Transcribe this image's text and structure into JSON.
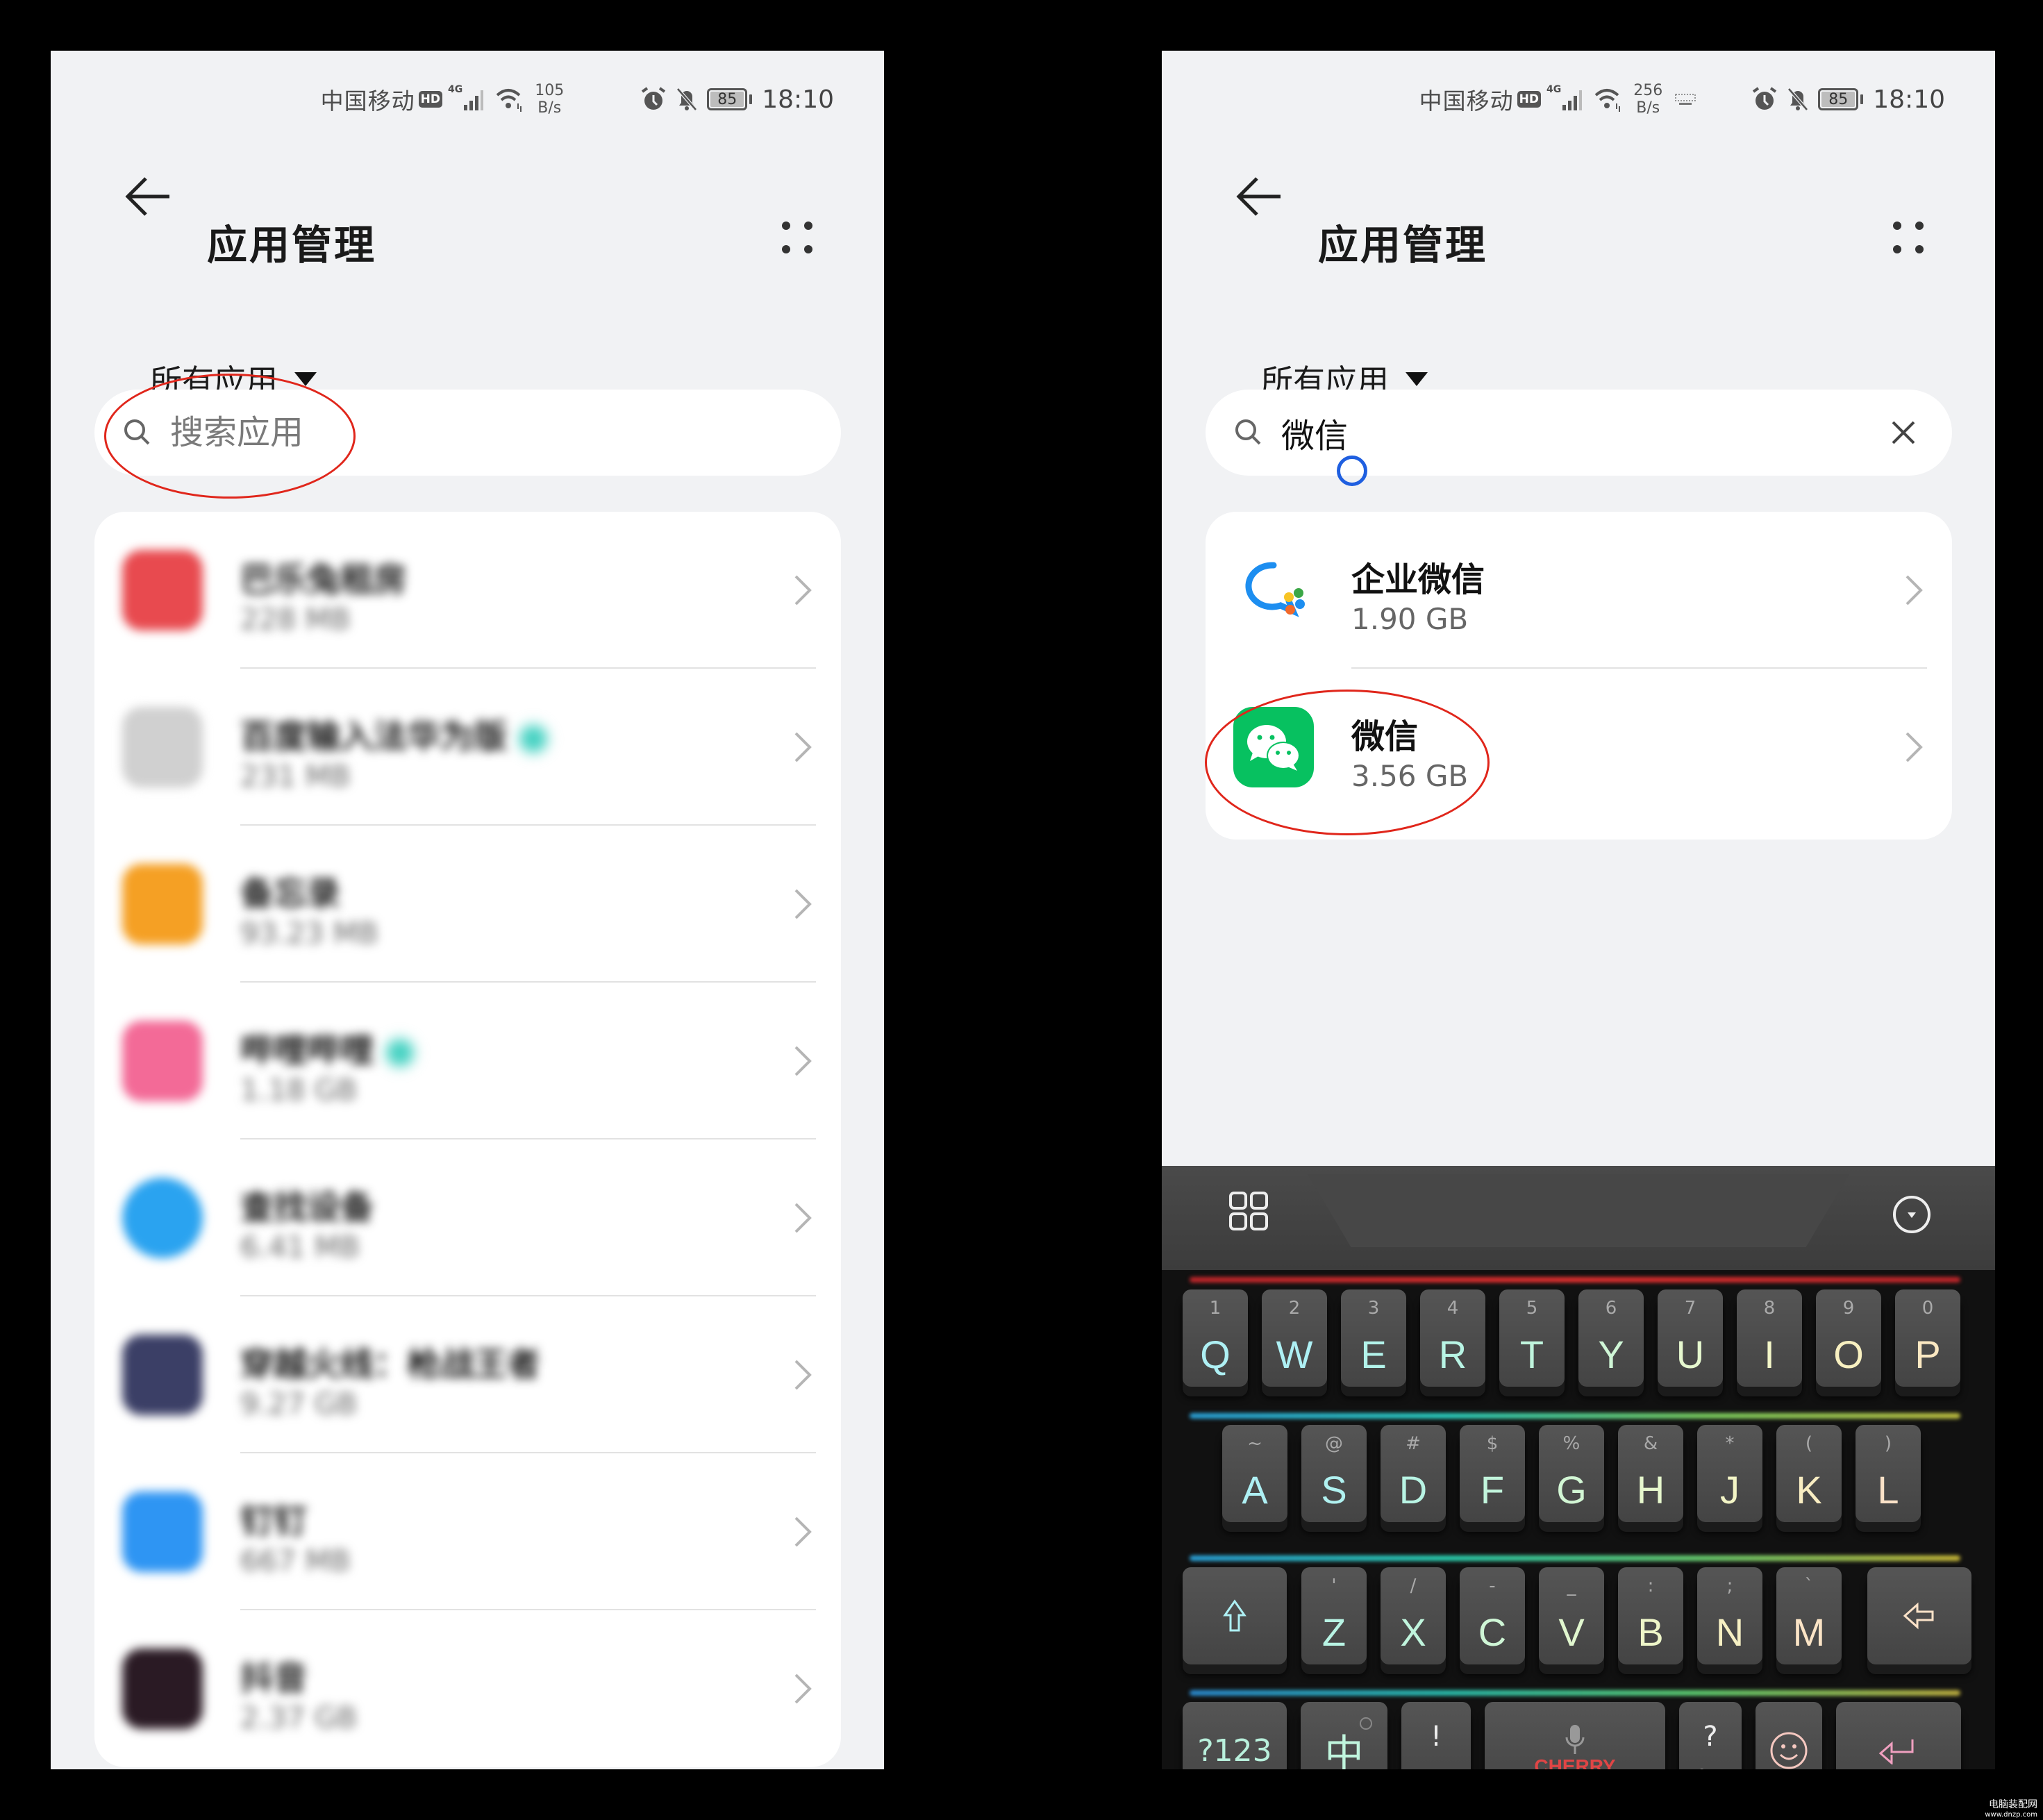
{
  "left_screen": {
    "status_bar": {
      "carrier": "中国移动",
      "hd_badge": "HD",
      "network": "4G",
      "speed_value": "105",
      "speed_unit": "B/s",
      "battery": "85",
      "time": "18:10"
    },
    "header": {
      "title": "应用管理"
    },
    "filter": {
      "label": "所有应用"
    },
    "search": {
      "placeholder": "搜索应用",
      "value": ""
    },
    "apps": [
      {
        "name": "巴乐兔租房",
        "size": "228 MB",
        "icon_color": "#e84a4f",
        "badge": false
      },
      {
        "name": "百度输入法华为版",
        "size": "231 MB",
        "icon_color": "#d0d0d0",
        "badge": true
      },
      {
        "name": "备忘录",
        "size": "93.23 MB",
        "icon_color": "#f5a024",
        "badge": false
      },
      {
        "name": "哔哩哔哩",
        "size": "1.18 GB",
        "icon_color": "#f36a97",
        "badge": true
      },
      {
        "name": "查找设备",
        "size": "6.41 MB",
        "icon_color": "#2aa3f0",
        "badge": false
      },
      {
        "name": "穿越火线：枪战王者",
        "size": "9.27 GB",
        "icon_color": "#3b3f66",
        "badge": false
      },
      {
        "name": "钉钉",
        "size": "667 MB",
        "icon_color": "#2e95f3",
        "badge": false
      },
      {
        "name": "抖音",
        "size": "2.37 GB",
        "icon_color": "#2a1a24",
        "badge": false
      }
    ]
  },
  "right_screen": {
    "status_bar": {
      "carrier": "中国移动",
      "hd_badge": "HD",
      "network": "4G",
      "speed_value": "256",
      "speed_unit": "B/s",
      "battery": "85",
      "time": "18:10"
    },
    "header": {
      "title": "应用管理"
    },
    "filter": {
      "label": "所有应用"
    },
    "search": {
      "placeholder": "搜索应用",
      "value": "微信"
    },
    "results": [
      {
        "name": "企业微信",
        "size": "1.90 GB",
        "icon": "wecom-icon"
      },
      {
        "name": "微信",
        "size": "3.56 GB",
        "icon": "wechat-icon",
        "highlighted": true
      }
    ],
    "keyboard": {
      "brand": "CHERRY",
      "row1": [
        {
          "main": "Q",
          "sub": "1",
          "color": "#aef0f4"
        },
        {
          "main": "W",
          "sub": "2",
          "color": "#aef0f4"
        },
        {
          "main": "E",
          "sub": "3",
          "color": "#b3f3ea"
        },
        {
          "main": "R",
          "sub": "4",
          "color": "#b8f4e4"
        },
        {
          "main": "T",
          "sub": "5",
          "color": "#c0f5dd"
        },
        {
          "main": "Y",
          "sub": "6",
          "color": "#cff6d6"
        },
        {
          "main": "U",
          "sub": "7",
          "color": "#e6f8cf"
        },
        {
          "main": "I",
          "sub": "8",
          "color": "#f3f6c8"
        },
        {
          "main": "O",
          "sub": "9",
          "color": "#f8f0c0"
        },
        {
          "main": "P",
          "sub": "0",
          "color": "#fbe8c2"
        }
      ],
      "row2": [
        {
          "main": "A",
          "sub": "~",
          "color": "#aef0f4"
        },
        {
          "main": "S",
          "sub": "@",
          "color": "#b0f1f0"
        },
        {
          "main": "D",
          "sub": "#",
          "color": "#b8f4e4"
        },
        {
          "main": "F",
          "sub": "$",
          "color": "#c2f5dc"
        },
        {
          "main": "G",
          "sub": "%",
          "color": "#d2f6d4"
        },
        {
          "main": "H",
          "sub": "&",
          "color": "#e6f7cd"
        },
        {
          "main": "J",
          "sub": "*",
          "color": "#f3f5c6"
        },
        {
          "main": "K",
          "sub": "(",
          "color": "#f8edc2"
        },
        {
          "main": "L",
          "sub": ")",
          "color": "#fbe2c8"
        }
      ],
      "row3": [
        {
          "main": "Z",
          "sub": "'",
          "color": "#b8f4e4"
        },
        {
          "main": "X",
          "sub": "/",
          "color": "#c0f5dd"
        },
        {
          "main": "C",
          "sub": "-",
          "color": "#cff6d6"
        },
        {
          "main": "V",
          "sub": "_",
          "color": "#e1f7cf"
        },
        {
          "main": "B",
          "sub": ":",
          "color": "#eef6c9"
        },
        {
          "main": "N",
          "sub": ";",
          "color": "#f6f0c3"
        },
        {
          "main": "M",
          "sub": "`",
          "color": "#fbe4c6"
        }
      ],
      "shift_icon": "shift-icon",
      "backspace_icon": "backspace-icon",
      "num_key": "?123",
      "lang_key": "中",
      "punct1_top": "!",
      "punct1_bottom": "，",
      "punct2_top": "?",
      "punct2_bottom": "。",
      "emoji_icon": "emoji-icon",
      "enter_icon": "enter-icon",
      "mic_icon": "mic-icon",
      "menu_icon": "grid-menu-icon",
      "hide_icon": "keyboard-hide-icon"
    }
  },
  "watermark": {
    "name": "电脑装配网",
    "url": "www.dnzp.com"
  },
  "colors": {
    "annotation_red": "#e0261b",
    "cursor_blue": "#1f5fe0",
    "wechat_green": "#07c160"
  }
}
